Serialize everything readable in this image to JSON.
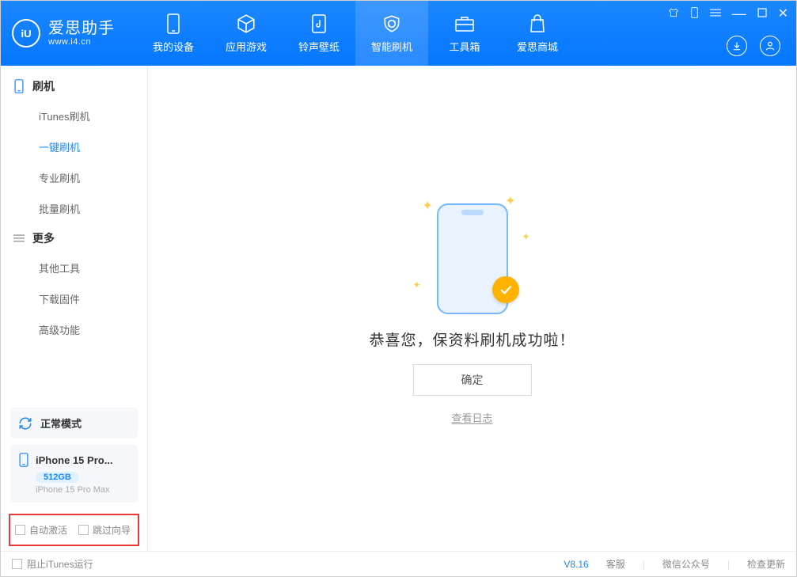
{
  "app": {
    "title": "爱思助手",
    "url": "www.i4.cn"
  },
  "nav": {
    "items": [
      {
        "label": "我的设备"
      },
      {
        "label": "应用游戏"
      },
      {
        "label": "铃声壁纸"
      },
      {
        "label": "智能刷机"
      },
      {
        "label": "工具箱"
      },
      {
        "label": "爱思商城"
      }
    ]
  },
  "sidebar": {
    "group1": {
      "title": "刷机",
      "items": [
        "iTunes刷机",
        "一键刷机",
        "专业刷机",
        "批量刷机"
      ]
    },
    "group2": {
      "title": "更多",
      "items": [
        "其他工具",
        "下载固件",
        "高级功能"
      ]
    },
    "mode": "正常模式",
    "device": {
      "name": "iPhone 15 Pro...",
      "storage": "512GB",
      "model": "iPhone 15 Pro Max"
    },
    "opts": {
      "auto_activate": "自动激活",
      "skip_guide": "跳过向导"
    }
  },
  "main": {
    "success": "恭喜您，保资料刷机成功啦！",
    "ok": "确定",
    "log": "查看日志"
  },
  "footer": {
    "block_itunes": "阻止iTunes运行",
    "version": "V8.16",
    "support": "客服",
    "wechat": "微信公众号",
    "update": "检查更新"
  }
}
